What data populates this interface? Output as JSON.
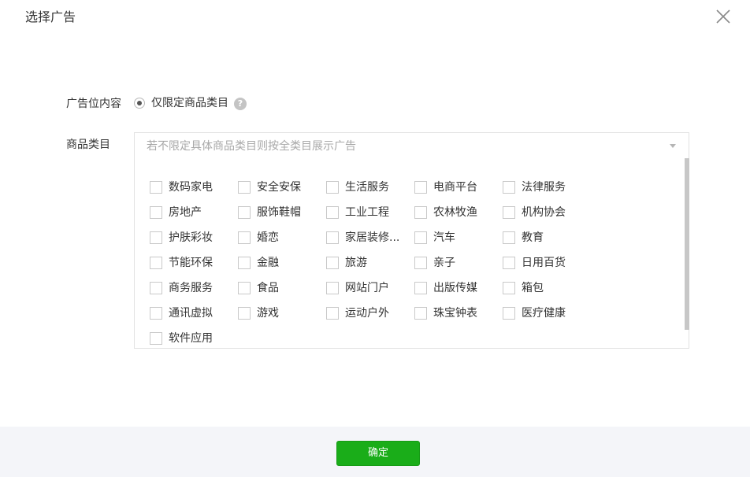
{
  "dialog": {
    "title": "选择广告",
    "ad_content_label": "广告位内容",
    "radio_option_label": "仅限定商品类目",
    "help_icon_text": "?",
    "category_label": "商品类目",
    "select_placeholder": "若不限定具体商品类目则按全类目展示广告",
    "confirm_label": "确定",
    "accent_color": "#1aad19"
  },
  "categories": [
    "数码家电",
    "安全安保",
    "生活服务",
    "电商平台",
    "法律服务",
    "房地产",
    "服饰鞋帽",
    "工业工程",
    "农林牧渔",
    "机构协会",
    "护肤彩妆",
    "婚恋",
    "家居装修...",
    "汽车",
    "教育",
    "节能环保",
    "金融",
    "旅游",
    "亲子",
    "日用百货",
    "商务服务",
    "食品",
    "网站门户",
    "出版传媒",
    "箱包",
    "通讯虚拟",
    "游戏",
    "运动户外",
    "珠宝钟表",
    "医疗健康",
    "软件应用"
  ]
}
